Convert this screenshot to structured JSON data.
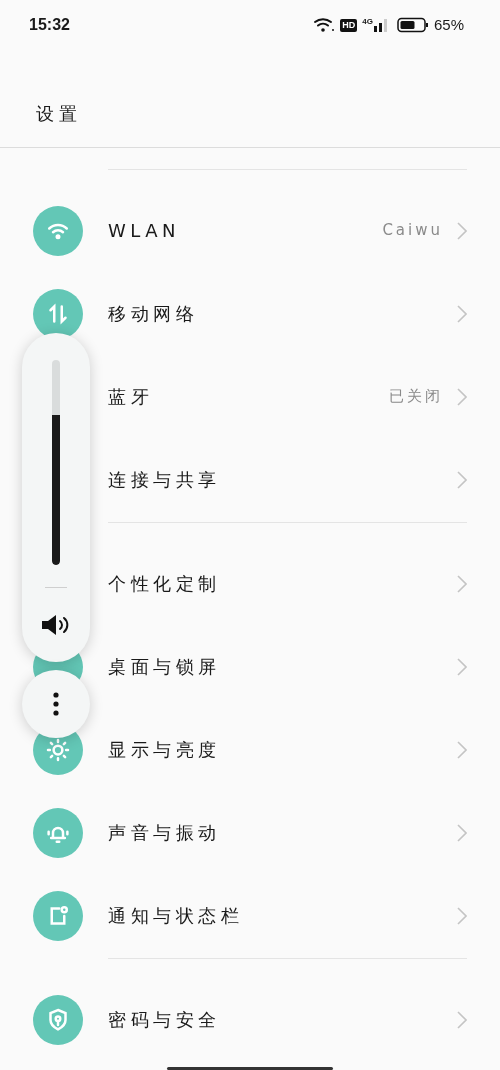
{
  "status_bar": {
    "time": "15:32",
    "hd": "HD",
    "network": "4G",
    "battery": "65%"
  },
  "title": "设置",
  "sections": [
    {
      "rows": [
        {
          "label": "WLAN",
          "value": "Caiwu",
          "kind": "wifi"
        },
        {
          "label": "移动网络",
          "kind": "mobile-data"
        },
        {
          "label": "蓝牙",
          "value": "已关闭",
          "kind": "plain"
        },
        {
          "label": "连接与共享",
          "kind": "plain"
        }
      ]
    },
    {
      "rows": [
        {
          "label": "个性化定制",
          "kind": "plain"
        },
        {
          "label": "桌面与锁屏",
          "kind": "blank"
        },
        {
          "label": "显示与亮度",
          "kind": "sun"
        },
        {
          "label": "声音与振动",
          "kind": "bell"
        },
        {
          "label": "通知与状态栏",
          "kind": "notification"
        }
      ]
    },
    {
      "rows": [
        {
          "label": "密码与安全",
          "kind": "shield"
        }
      ]
    }
  ],
  "volume_panel": {
    "level": 0.73
  }
}
